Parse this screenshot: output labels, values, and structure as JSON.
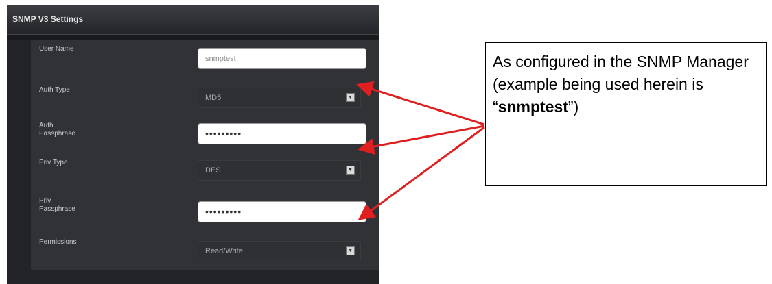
{
  "panel": {
    "title": "SNMP V3 Settings"
  },
  "form": {
    "rows": [
      {
        "label": "User Name",
        "kind": "text",
        "value": "snmptest"
      },
      {
        "label": "Auth Type",
        "kind": "select",
        "value": "MD5"
      },
      {
        "label": "Auth\nPassphrase",
        "kind": "password",
        "value": "•••••••••"
      },
      {
        "label": "Priv Type",
        "kind": "select",
        "value": "DES"
      },
      {
        "label": "Priv\nPassphrase",
        "kind": "password",
        "value": "•••••••••"
      },
      {
        "label": "Permissions",
        "kind": "select",
        "value": "Read/Write"
      }
    ]
  },
  "callout": {
    "text_before": "As configured in the SNMP Manager (example being used herein is “",
    "highlight": "snmptest",
    "text_after": "”)"
  },
  "colors": {
    "arrow": "#e02020",
    "panel_bg": "#222327",
    "row_bg": "#303236"
  },
  "icons": {
    "select_arrow": "chevron-down-icon"
  }
}
